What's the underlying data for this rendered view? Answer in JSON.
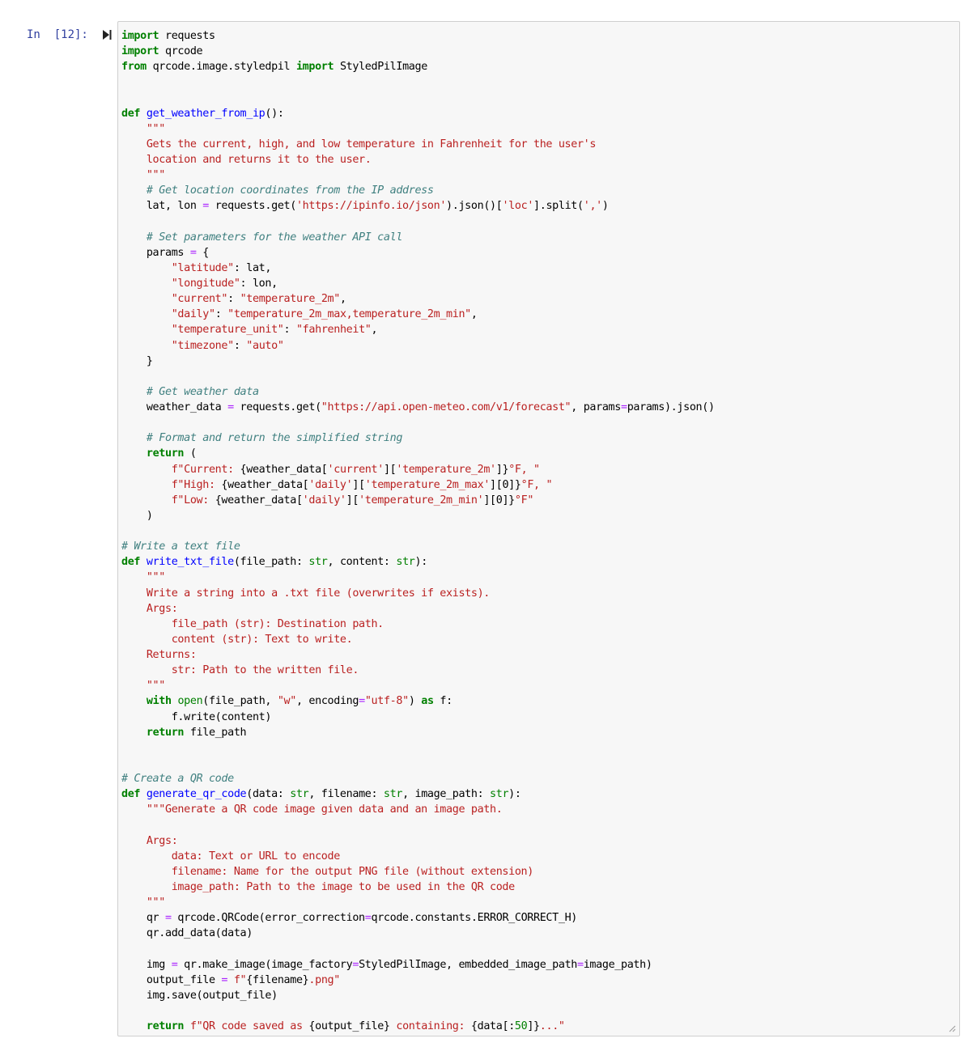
{
  "cell": {
    "prompt": "In  [12]:",
    "top_clipped_text": "",
    "lines": [
      [
        {
          "t": "import",
          "c": "kw"
        },
        {
          "t": " requests",
          "c": ""
        }
      ],
      [
        {
          "t": "import",
          "c": "kw"
        },
        {
          "t": " qrcode",
          "c": ""
        }
      ],
      [
        {
          "t": "from",
          "c": "kw"
        },
        {
          "t": " qrcode.image.styledpil ",
          "c": ""
        },
        {
          "t": "import",
          "c": "kw"
        },
        {
          "t": " StyledPilImage",
          "c": ""
        }
      ],
      [],
      [],
      [
        {
          "t": "def",
          "c": "kw"
        },
        {
          "t": " ",
          "c": ""
        },
        {
          "t": "get_weather_from_ip",
          "c": "fn"
        },
        {
          "t": "():",
          "c": ""
        }
      ],
      [
        {
          "t": "    \"\"\"",
          "c": "doc"
        }
      ],
      [
        {
          "t": "    Gets the current, high, and low temperature in Fahrenheit for the user's",
          "c": "doc"
        }
      ],
      [
        {
          "t": "    location and returns it to the user.",
          "c": "doc"
        }
      ],
      [
        {
          "t": "    \"\"\"",
          "c": "doc"
        }
      ],
      [
        {
          "t": "    # Get location coordinates from the IP address",
          "c": "cm"
        }
      ],
      [
        {
          "t": "    lat, lon ",
          "c": ""
        },
        {
          "t": "=",
          "c": "op"
        },
        {
          "t": " requests.get(",
          "c": ""
        },
        {
          "t": "'https://ipinfo.io/json'",
          "c": "str"
        },
        {
          "t": ").json()[",
          "c": ""
        },
        {
          "t": "'loc'",
          "c": "str"
        },
        {
          "t": "].split(",
          "c": ""
        },
        {
          "t": "','",
          "c": "str"
        },
        {
          "t": ")",
          "c": ""
        }
      ],
      [],
      [
        {
          "t": "    # Set parameters for the weather API call",
          "c": "cm"
        }
      ],
      [
        {
          "t": "    params ",
          "c": ""
        },
        {
          "t": "=",
          "c": "op"
        },
        {
          "t": " {",
          "c": ""
        }
      ],
      [
        {
          "t": "        ",
          "c": ""
        },
        {
          "t": "\"latitude\"",
          "c": "str"
        },
        {
          "t": ": lat,",
          "c": ""
        }
      ],
      [
        {
          "t": "        ",
          "c": ""
        },
        {
          "t": "\"longitude\"",
          "c": "str"
        },
        {
          "t": ": lon,",
          "c": ""
        }
      ],
      [
        {
          "t": "        ",
          "c": ""
        },
        {
          "t": "\"current\"",
          "c": "str"
        },
        {
          "t": ": ",
          "c": ""
        },
        {
          "t": "\"temperature_2m\"",
          "c": "str"
        },
        {
          "t": ",",
          "c": ""
        }
      ],
      [
        {
          "t": "        ",
          "c": ""
        },
        {
          "t": "\"daily\"",
          "c": "str"
        },
        {
          "t": ": ",
          "c": ""
        },
        {
          "t": "\"temperature_2m_max,temperature_2m_min\"",
          "c": "str"
        },
        {
          "t": ",",
          "c": ""
        }
      ],
      [
        {
          "t": "        ",
          "c": ""
        },
        {
          "t": "\"temperature_unit\"",
          "c": "str"
        },
        {
          "t": ": ",
          "c": ""
        },
        {
          "t": "\"fahrenheit\"",
          "c": "str"
        },
        {
          "t": ",",
          "c": ""
        }
      ],
      [
        {
          "t": "        ",
          "c": ""
        },
        {
          "t": "\"timezone\"",
          "c": "str"
        },
        {
          "t": ": ",
          "c": ""
        },
        {
          "t": "\"auto\"",
          "c": "str"
        }
      ],
      [
        {
          "t": "    }",
          "c": ""
        }
      ],
      [],
      [
        {
          "t": "    # Get weather data",
          "c": "cm"
        }
      ],
      [
        {
          "t": "    weather_data ",
          "c": ""
        },
        {
          "t": "=",
          "c": "op"
        },
        {
          "t": " requests.get(",
          "c": ""
        },
        {
          "t": "\"https://api.open-meteo.com/v1/forecast\"",
          "c": "str"
        },
        {
          "t": ", params",
          "c": ""
        },
        {
          "t": "=",
          "c": "op"
        },
        {
          "t": "params).json()",
          "c": ""
        }
      ],
      [],
      [
        {
          "t": "    # Format and return the simplified string",
          "c": "cm"
        }
      ],
      [
        {
          "t": "    ",
          "c": ""
        },
        {
          "t": "return",
          "c": "kw"
        },
        {
          "t": " (",
          "c": ""
        }
      ],
      [
        {
          "t": "        ",
          "c": ""
        },
        {
          "t": "f\"Current: ",
          "c": "str"
        },
        {
          "t": "{weather_data[",
          "c": ""
        },
        {
          "t": "'current'",
          "c": "str"
        },
        {
          "t": "][",
          "c": ""
        },
        {
          "t": "'temperature_2m'",
          "c": "str"
        },
        {
          "t": "]}",
          "c": ""
        },
        {
          "t": "°F, \"",
          "c": "str"
        }
      ],
      [
        {
          "t": "        ",
          "c": ""
        },
        {
          "t": "f\"High: ",
          "c": "str"
        },
        {
          "t": "{weather_data[",
          "c": ""
        },
        {
          "t": "'daily'",
          "c": "str"
        },
        {
          "t": "][",
          "c": ""
        },
        {
          "t": "'temperature_2m_max'",
          "c": "str"
        },
        {
          "t": "][0]}",
          "c": ""
        },
        {
          "t": "°F, \"",
          "c": "str"
        }
      ],
      [
        {
          "t": "        ",
          "c": ""
        },
        {
          "t": "f\"Low: ",
          "c": "str"
        },
        {
          "t": "{weather_data[",
          "c": ""
        },
        {
          "t": "'daily'",
          "c": "str"
        },
        {
          "t": "][",
          "c": ""
        },
        {
          "t": "'temperature_2m_min'",
          "c": "str"
        },
        {
          "t": "][0]}",
          "c": ""
        },
        {
          "t": "°F\"",
          "c": "str"
        }
      ],
      [
        {
          "t": "    )",
          "c": ""
        }
      ],
      [],
      [
        {
          "t": "# Write a text file",
          "c": "cm"
        }
      ],
      [
        {
          "t": "def",
          "c": "kw"
        },
        {
          "t": " ",
          "c": ""
        },
        {
          "t": "write_txt_file",
          "c": "fn"
        },
        {
          "t": "(file_path: ",
          "c": ""
        },
        {
          "t": "str",
          "c": "bi"
        },
        {
          "t": ", content: ",
          "c": ""
        },
        {
          "t": "str",
          "c": "bi"
        },
        {
          "t": "):",
          "c": ""
        }
      ],
      [
        {
          "t": "    \"\"\"",
          "c": "doc"
        }
      ],
      [
        {
          "t": "    Write a string into a .txt file (overwrites if exists).",
          "c": "doc"
        }
      ],
      [
        {
          "t": "    Args:",
          "c": "doc"
        }
      ],
      [
        {
          "t": "        file_path (str): Destination path.",
          "c": "doc"
        }
      ],
      [
        {
          "t": "        content (str): Text to write.",
          "c": "doc"
        }
      ],
      [
        {
          "t": "    Returns:",
          "c": "doc"
        }
      ],
      [
        {
          "t": "        str: Path to the written file.",
          "c": "doc"
        }
      ],
      [
        {
          "t": "    \"\"\"",
          "c": "doc"
        }
      ],
      [
        {
          "t": "    ",
          "c": ""
        },
        {
          "t": "with",
          "c": "kw"
        },
        {
          "t": " ",
          "c": ""
        },
        {
          "t": "open",
          "c": "bi"
        },
        {
          "t": "(file_path, ",
          "c": ""
        },
        {
          "t": "\"w\"",
          "c": "str"
        },
        {
          "t": ", encoding",
          "c": ""
        },
        {
          "t": "=",
          "c": "op"
        },
        {
          "t": "\"utf-8\"",
          "c": "str"
        },
        {
          "t": ") ",
          "c": ""
        },
        {
          "t": "as",
          "c": "kw"
        },
        {
          "t": " f:",
          "c": ""
        }
      ],
      [
        {
          "t": "        f.write(content)",
          "c": ""
        }
      ],
      [
        {
          "t": "    ",
          "c": ""
        },
        {
          "t": "return",
          "c": "kw"
        },
        {
          "t": " file_path",
          "c": ""
        }
      ],
      [],
      [],
      [
        {
          "t": "# Create a QR code",
          "c": "cm"
        }
      ],
      [
        {
          "t": "def",
          "c": "kw"
        },
        {
          "t": " ",
          "c": ""
        },
        {
          "t": "generate_qr_code",
          "c": "fn"
        },
        {
          "t": "(data: ",
          "c": ""
        },
        {
          "t": "str",
          "c": "bi"
        },
        {
          "t": ", filename: ",
          "c": ""
        },
        {
          "t": "str",
          "c": "bi"
        },
        {
          "t": ", image_path: ",
          "c": ""
        },
        {
          "t": "str",
          "c": "bi"
        },
        {
          "t": "):",
          "c": ""
        }
      ],
      [
        {
          "t": "    \"\"\"Generate a QR code image given data and an image path.",
          "c": "doc"
        }
      ],
      [],
      [
        {
          "t": "    Args:",
          "c": "doc"
        }
      ],
      [
        {
          "t": "        data: Text or URL to encode",
          "c": "doc"
        }
      ],
      [
        {
          "t": "        filename: Name for the output PNG file (without extension)",
          "c": "doc"
        }
      ],
      [
        {
          "t": "        image_path: Path to the image to be used in the QR code",
          "c": "doc"
        }
      ],
      [
        {
          "t": "    \"\"\"",
          "c": "doc"
        }
      ],
      [
        {
          "t": "    qr ",
          "c": ""
        },
        {
          "t": "=",
          "c": "op"
        },
        {
          "t": " qrcode.QRCode(error_correction",
          "c": ""
        },
        {
          "t": "=",
          "c": "op"
        },
        {
          "t": "qrcode.constants.ERROR_CORRECT_H)",
          "c": ""
        }
      ],
      [
        {
          "t": "    qr.add_data(data)",
          "c": ""
        }
      ],
      [],
      [
        {
          "t": "    img ",
          "c": ""
        },
        {
          "t": "=",
          "c": "op"
        },
        {
          "t": " qr.make_image(image_factory",
          "c": ""
        },
        {
          "t": "=",
          "c": "op"
        },
        {
          "t": "StyledPilImage, embedded_image_path",
          "c": ""
        },
        {
          "t": "=",
          "c": "op"
        },
        {
          "t": "image_path)",
          "c": ""
        }
      ],
      [
        {
          "t": "    output_file ",
          "c": ""
        },
        {
          "t": "=",
          "c": "op"
        },
        {
          "t": " ",
          "c": ""
        },
        {
          "t": "f\"",
          "c": "str"
        },
        {
          "t": "{filename}",
          "c": ""
        },
        {
          "t": ".png\"",
          "c": "str"
        }
      ],
      [
        {
          "t": "    img.save(output_file)",
          "c": ""
        }
      ],
      [],
      [
        {
          "t": "    ",
          "c": ""
        },
        {
          "t": "return",
          "c": "kw"
        },
        {
          "t": " ",
          "c": ""
        },
        {
          "t": "f\"QR code saved as ",
          "c": "str"
        },
        {
          "t": "{output_file}",
          "c": ""
        },
        {
          "t": " containing: ",
          "c": "str"
        },
        {
          "t": "{data[:",
          "c": ""
        },
        {
          "t": "50",
          "c": "num"
        },
        {
          "t": "]}",
          "c": ""
        },
        {
          "t": "...\"",
          "c": "str"
        }
      ]
    ]
  },
  "icons": {
    "run": "run-cell-icon",
    "resize": "resize-handle-icon"
  },
  "colors": {
    "prompt": "#303f9f",
    "cell_background": "#f7f7f7",
    "cell_border": "#cfcfcf"
  }
}
